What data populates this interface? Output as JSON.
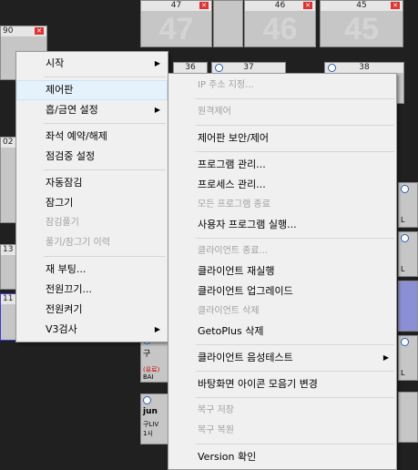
{
  "tiles": {
    "top": [
      {
        "num": "47",
        "big": "47"
      },
      {
        "num": "46",
        "big": "46"
      },
      {
        "num": "45",
        "big": "45"
      }
    ],
    "mid": [
      "36",
      "37",
      "38"
    ],
    "left_nums": [
      "90",
      "02",
      "13",
      "11"
    ],
    "frag": {
      "tile_lower_1": "구",
      "tile_lower_2": "(유료)",
      "tile_lower_3": "BAI",
      "tile_bottom_1": "jun",
      "tile_bottom_2": "구LIV",
      "tile_bottom_3": "1시",
      "right_1": "L",
      "right_2": "L",
      "right_3": "L"
    }
  },
  "menu_main": [
    {
      "label": "시작",
      "submenu": true
    },
    {
      "sep": true
    },
    {
      "label": "제어판",
      "highlight": true
    },
    {
      "label": "흡/금연 설정",
      "submenu": true
    },
    {
      "sep": true
    },
    {
      "label": "좌석 예약/해제"
    },
    {
      "label": "점검중 설정"
    },
    {
      "sep": true
    },
    {
      "label": "자동잠김"
    },
    {
      "label": "잠그기"
    },
    {
      "label": "잠김풀기",
      "disabled": true
    },
    {
      "label": "풀기/잠그기 이력",
      "disabled": true
    },
    {
      "sep": true
    },
    {
      "label": "재 부팅..."
    },
    {
      "label": "전원끄기..."
    },
    {
      "label": "전원켜기"
    },
    {
      "label": "V3검사",
      "submenu": true
    }
  ],
  "menu_sub": [
    {
      "label": "IP 주소 지정...",
      "disabled": true
    },
    {
      "sep": true
    },
    {
      "label": "원격제어",
      "disabled": true
    },
    {
      "sep": true
    },
    {
      "label": "제어판 보안/제어"
    },
    {
      "sep": true
    },
    {
      "label": "프로그램 관리..."
    },
    {
      "label": "프로세스 관리..."
    },
    {
      "label": "모든 프로그램 종료",
      "disabled": true
    },
    {
      "label": "사용자 프로그램 실행..."
    },
    {
      "sep": true
    },
    {
      "label": "클라이언트 종료...",
      "disabled": true
    },
    {
      "label": "클라이언트 재실행"
    },
    {
      "label": "클라이언트 업그레이드"
    },
    {
      "label": "클라이언트 삭제",
      "disabled": true
    },
    {
      "label": "GetoPlus 삭제"
    },
    {
      "sep": true
    },
    {
      "label": "클라이언트 음성테스트",
      "submenu": true
    },
    {
      "sep": true
    },
    {
      "label": "바탕화면 아이콘 모음기 변경"
    },
    {
      "sep": true
    },
    {
      "label": "복구 저장",
      "disabled": true
    },
    {
      "label": "복구 복원",
      "disabled": true
    },
    {
      "sep": true
    },
    {
      "label": "Version 확인"
    }
  ]
}
